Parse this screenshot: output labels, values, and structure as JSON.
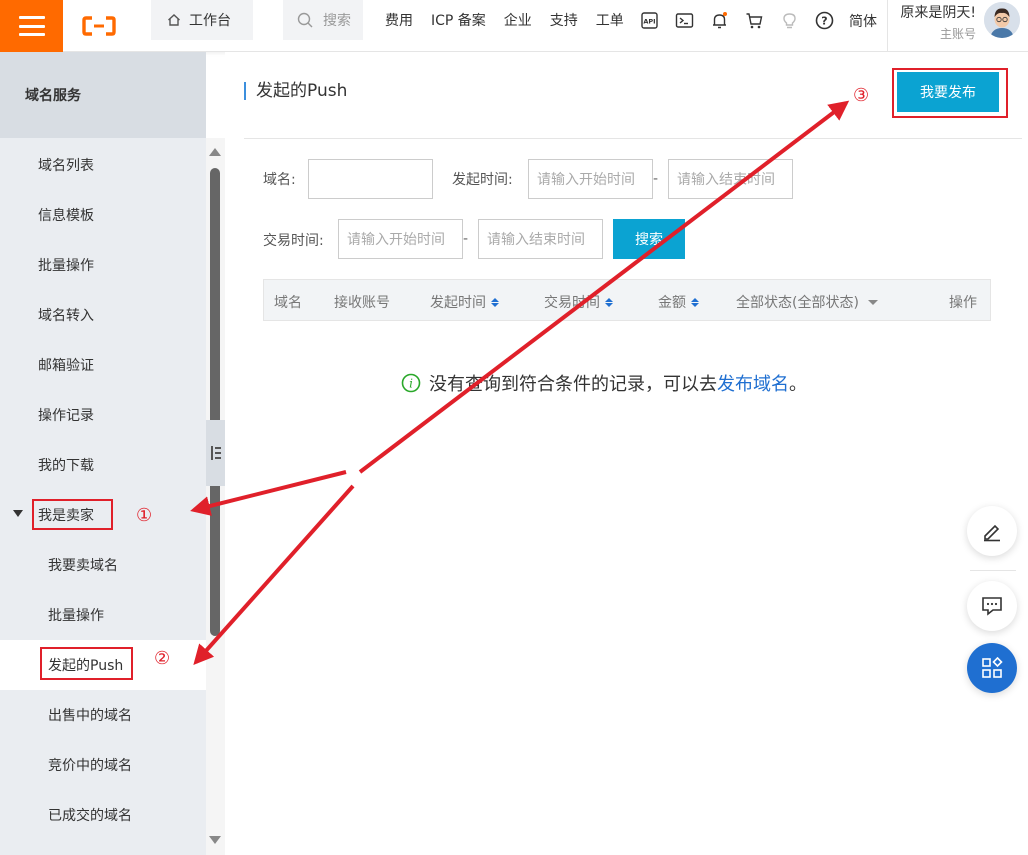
{
  "topbar": {
    "workbench": "工作台",
    "search_placeholder": "搜索",
    "nav": [
      "费用",
      "ICP 备案",
      "企业",
      "支持",
      "工单"
    ],
    "icons": [
      "api-icon",
      "terminal-icon",
      "bell-icon",
      "cart-icon",
      "lightbulb-icon",
      "help-icon"
    ],
    "lang": "简体",
    "user_name": "原来是阴天!",
    "user_role": "主账号",
    "brand_color": "#ff6a00"
  },
  "sidebar": {
    "title": "域名服务",
    "items": [
      {
        "label": "域名列表"
      },
      {
        "label": "信息模板"
      },
      {
        "label": "批量操作"
      },
      {
        "label": "域名转入"
      },
      {
        "label": "邮箱验证"
      },
      {
        "label": "操作记录"
      },
      {
        "label": "我的下载"
      },
      {
        "label": "我是卖家"
      },
      {
        "label": "我要卖域名"
      },
      {
        "label": "批量操作"
      },
      {
        "label": "发起的Push"
      },
      {
        "label": "出售中的域名"
      },
      {
        "label": "竞价中的域名"
      },
      {
        "label": "已成交的域名"
      }
    ],
    "active": "发起的Push"
  },
  "main": {
    "title": "发起的Push",
    "publish_button": "我要发布",
    "filters": {
      "domain_label": "域名:",
      "initiate_time_label": "发起时间:",
      "trade_time_label": "交易时间:",
      "start_placeholder": "请输入开始时间",
      "end_placeholder": "请输入结束时间",
      "dash": "-",
      "search_button": "搜索"
    },
    "table_headers": [
      "域名",
      "接收账号",
      "发起时间",
      "交易时间",
      "金额",
      "全部状态(全部状态)",
      "操作"
    ],
    "empty_text": "没有查询到符合条件的记录，可以去",
    "empty_link": "发布域名",
    "empty_end": "。"
  },
  "annotations": {
    "marker1": "①",
    "marker2": "②",
    "marker3": "③",
    "color": "#e0202a"
  }
}
